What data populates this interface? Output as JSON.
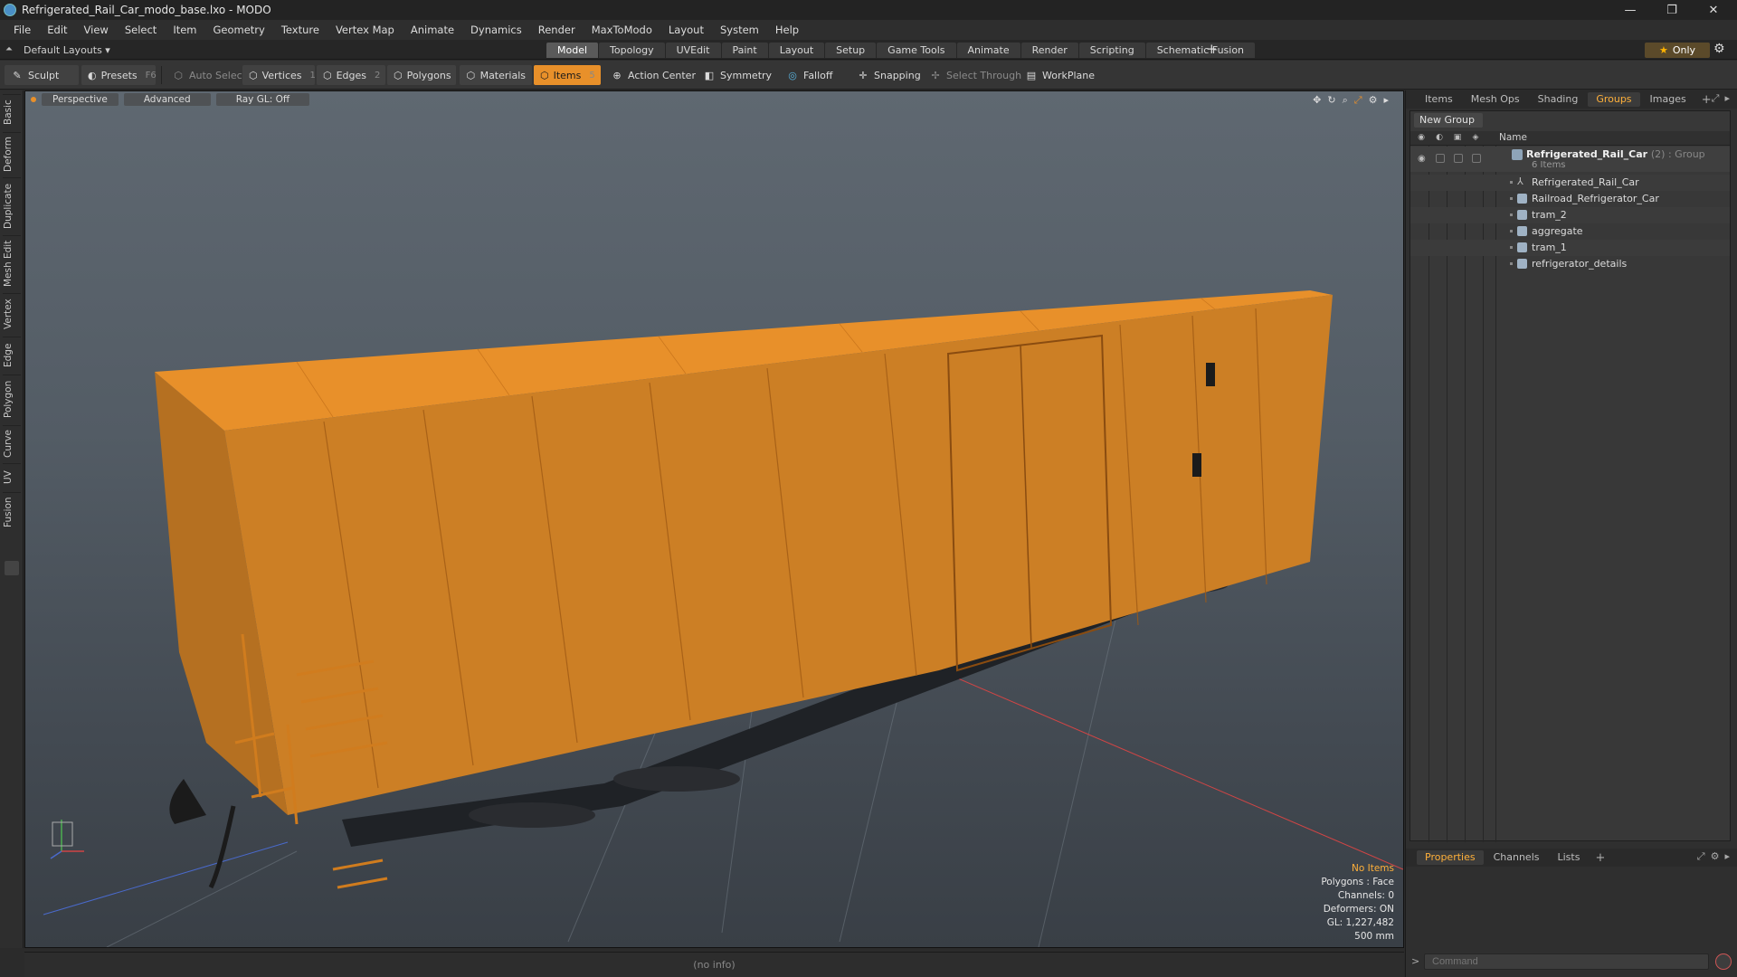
{
  "window": {
    "title": "Refrigerated_Rail_Car_modo_base.lxo - MODO",
    "controls": [
      "—",
      "❐",
      "✕"
    ]
  },
  "menu": [
    "File",
    "Edit",
    "View",
    "Select",
    "Item",
    "Geometry",
    "Texture",
    "Vertex Map",
    "Animate",
    "Dynamics",
    "Render",
    "MaxToModo",
    "Layout",
    "System",
    "Help"
  ],
  "layoutbar": {
    "layout_switch": "Default Layouts ▾",
    "tabs": [
      "Model",
      "Topology",
      "UVEdit",
      "Paint",
      "Layout",
      "Setup",
      "Game Tools",
      "Animate",
      "Render",
      "Scripting",
      "Schematic Fusion"
    ],
    "active_tab": "Model",
    "only_label": "Only"
  },
  "toolbar": {
    "sculpt": "Sculpt",
    "presets": "Presets",
    "presets_key": "F6",
    "auto_select": "Auto Select",
    "vertices": "Vertices",
    "vertices_key": "1",
    "edges": "Edges",
    "edges_key": "2",
    "polygons": "Polygons",
    "materials": "Materials",
    "items": "Items",
    "items_key": "5",
    "action_center": "Action Center",
    "symmetry": "Symmetry",
    "falloff": "Falloff",
    "snapping": "Snapping",
    "select_through": "Select Through",
    "workplane": "WorkPlane"
  },
  "left_tabs": [
    "Basic",
    "Deform",
    "Duplicate",
    "Mesh Edit",
    "Vertex",
    "Edge",
    "Polygon",
    "Curve",
    "UV",
    "Fusion"
  ],
  "viewport": {
    "view_mode": "Perspective",
    "shading": "Advanced",
    "raygl": "Ray GL: Off",
    "info": {
      "items": "No Items",
      "polygons": "Polygons : Face",
      "channels": "Channels: 0",
      "deformers": "Deformers: ON",
      "gl": "GL: 1,227,482",
      "scale": "500 mm"
    },
    "model_color": "#e8902a"
  },
  "status": "(no info)",
  "right_panel": {
    "top_tabs": [
      "Items",
      "Mesh Ops",
      "Shading",
      "Groups",
      "Images"
    ],
    "active_top_tab": "Groups",
    "new_group": "New Group",
    "column_name": "Name",
    "group": {
      "name": "Refrigerated_Rail_Car",
      "meta": "(2) : Group",
      "sub": "6 Items"
    },
    "items": [
      "Refrigerated_Rail_Car",
      "Railroad_Refrigerator_Car",
      "tram_2",
      "aggregate",
      "tram_1",
      "refrigerator_details"
    ],
    "bottom_tabs": [
      "Properties",
      "Channels",
      "Lists"
    ],
    "active_bottom_tab": "Properties",
    "command_placeholder": "Command"
  }
}
